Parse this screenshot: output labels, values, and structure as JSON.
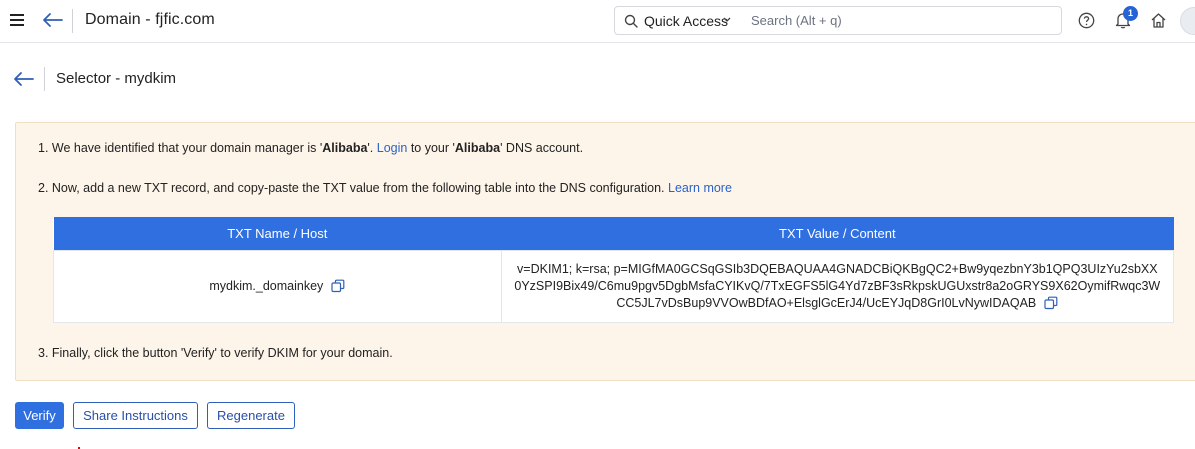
{
  "header": {
    "title": "Domain - fjfic.com",
    "quick_access_label": "Quick Access",
    "search_placeholder": "Search (Alt + q)",
    "notification_count": "1"
  },
  "subheader": {
    "title": "Selector - mydkim"
  },
  "instructions": {
    "step1": {
      "prefix": "1. We have identified that your domain manager is '",
      "manager": "Alibaba",
      "middle": "'. ",
      "login_link": "Login",
      "middle2": " to your '",
      "manager2": "Alibaba",
      "suffix": "' DNS account."
    },
    "step2": {
      "text": "2. Now, add a new TXT record, and copy-paste the TXT value from the following table into the DNS configuration.",
      "learn_more": "Learn more"
    },
    "step3": "3. Finally, click the button 'Verify' to verify DKIM for your domain."
  },
  "dns_table": {
    "headers": [
      "TXT Name / Host",
      "TXT Value / Content"
    ],
    "rows": [
      {
        "name": "mydkim._domainkey",
        "value": "v=DKIM1; k=rsa; p=MIGfMA0GCSqGSIb3DQEBAQUAA4GNADCBiQKBgQC2+Bw9yqezbnY3b1QPQ3UIzYu2sbXX0YzSPI9Bix49/C6mu9pgv5DgbMsfaCYIKvQ/7TxEGFS5lG4Yd7zBF3sRkpskUGUxstr8a2oGRYS9X62OymifRwqc3WCC5JL7vDsBup9VVOwBDfAO+ElsglGcErJ4/UcEYJqD8GrI0LvNywIDAQAB"
      }
    ]
  },
  "buttons": {
    "verify": "Verify",
    "share": "Share Instructions",
    "regenerate": "Regenerate"
  },
  "colors": {
    "accent": "#2f6fe0",
    "panel_bg": "#fdf5ea",
    "link": "#2a62c9"
  }
}
